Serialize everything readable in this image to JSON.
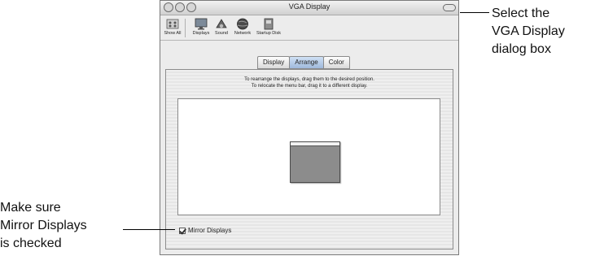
{
  "window": {
    "title": "VGA Display"
  },
  "toolbar": {
    "items": [
      {
        "label": "Show All",
        "icon": "show-all-icon"
      },
      {
        "label": "Displays",
        "icon": "displays-icon"
      },
      {
        "label": "Sound",
        "icon": "sound-icon"
      },
      {
        "label": "Network",
        "icon": "network-icon"
      },
      {
        "label": "Startup Disk",
        "icon": "startup-disk-icon"
      }
    ]
  },
  "tabs": [
    {
      "label": "Display",
      "selected": false
    },
    {
      "label": "Arrange",
      "selected": true
    },
    {
      "label": "Color",
      "selected": false
    }
  ],
  "panel": {
    "instruction_line1": "To rearrange the displays, drag them to the desired position.",
    "instruction_line2": "To relocate the menu bar, drag it to a different display.",
    "mirror_label": "Mirror Displays",
    "mirror_checked": true
  },
  "callouts": {
    "right": [
      "Select the",
      "VGA Display",
      "dialog box"
    ],
    "left": [
      "Make sure",
      "Mirror Displays",
      "is checked"
    ]
  }
}
